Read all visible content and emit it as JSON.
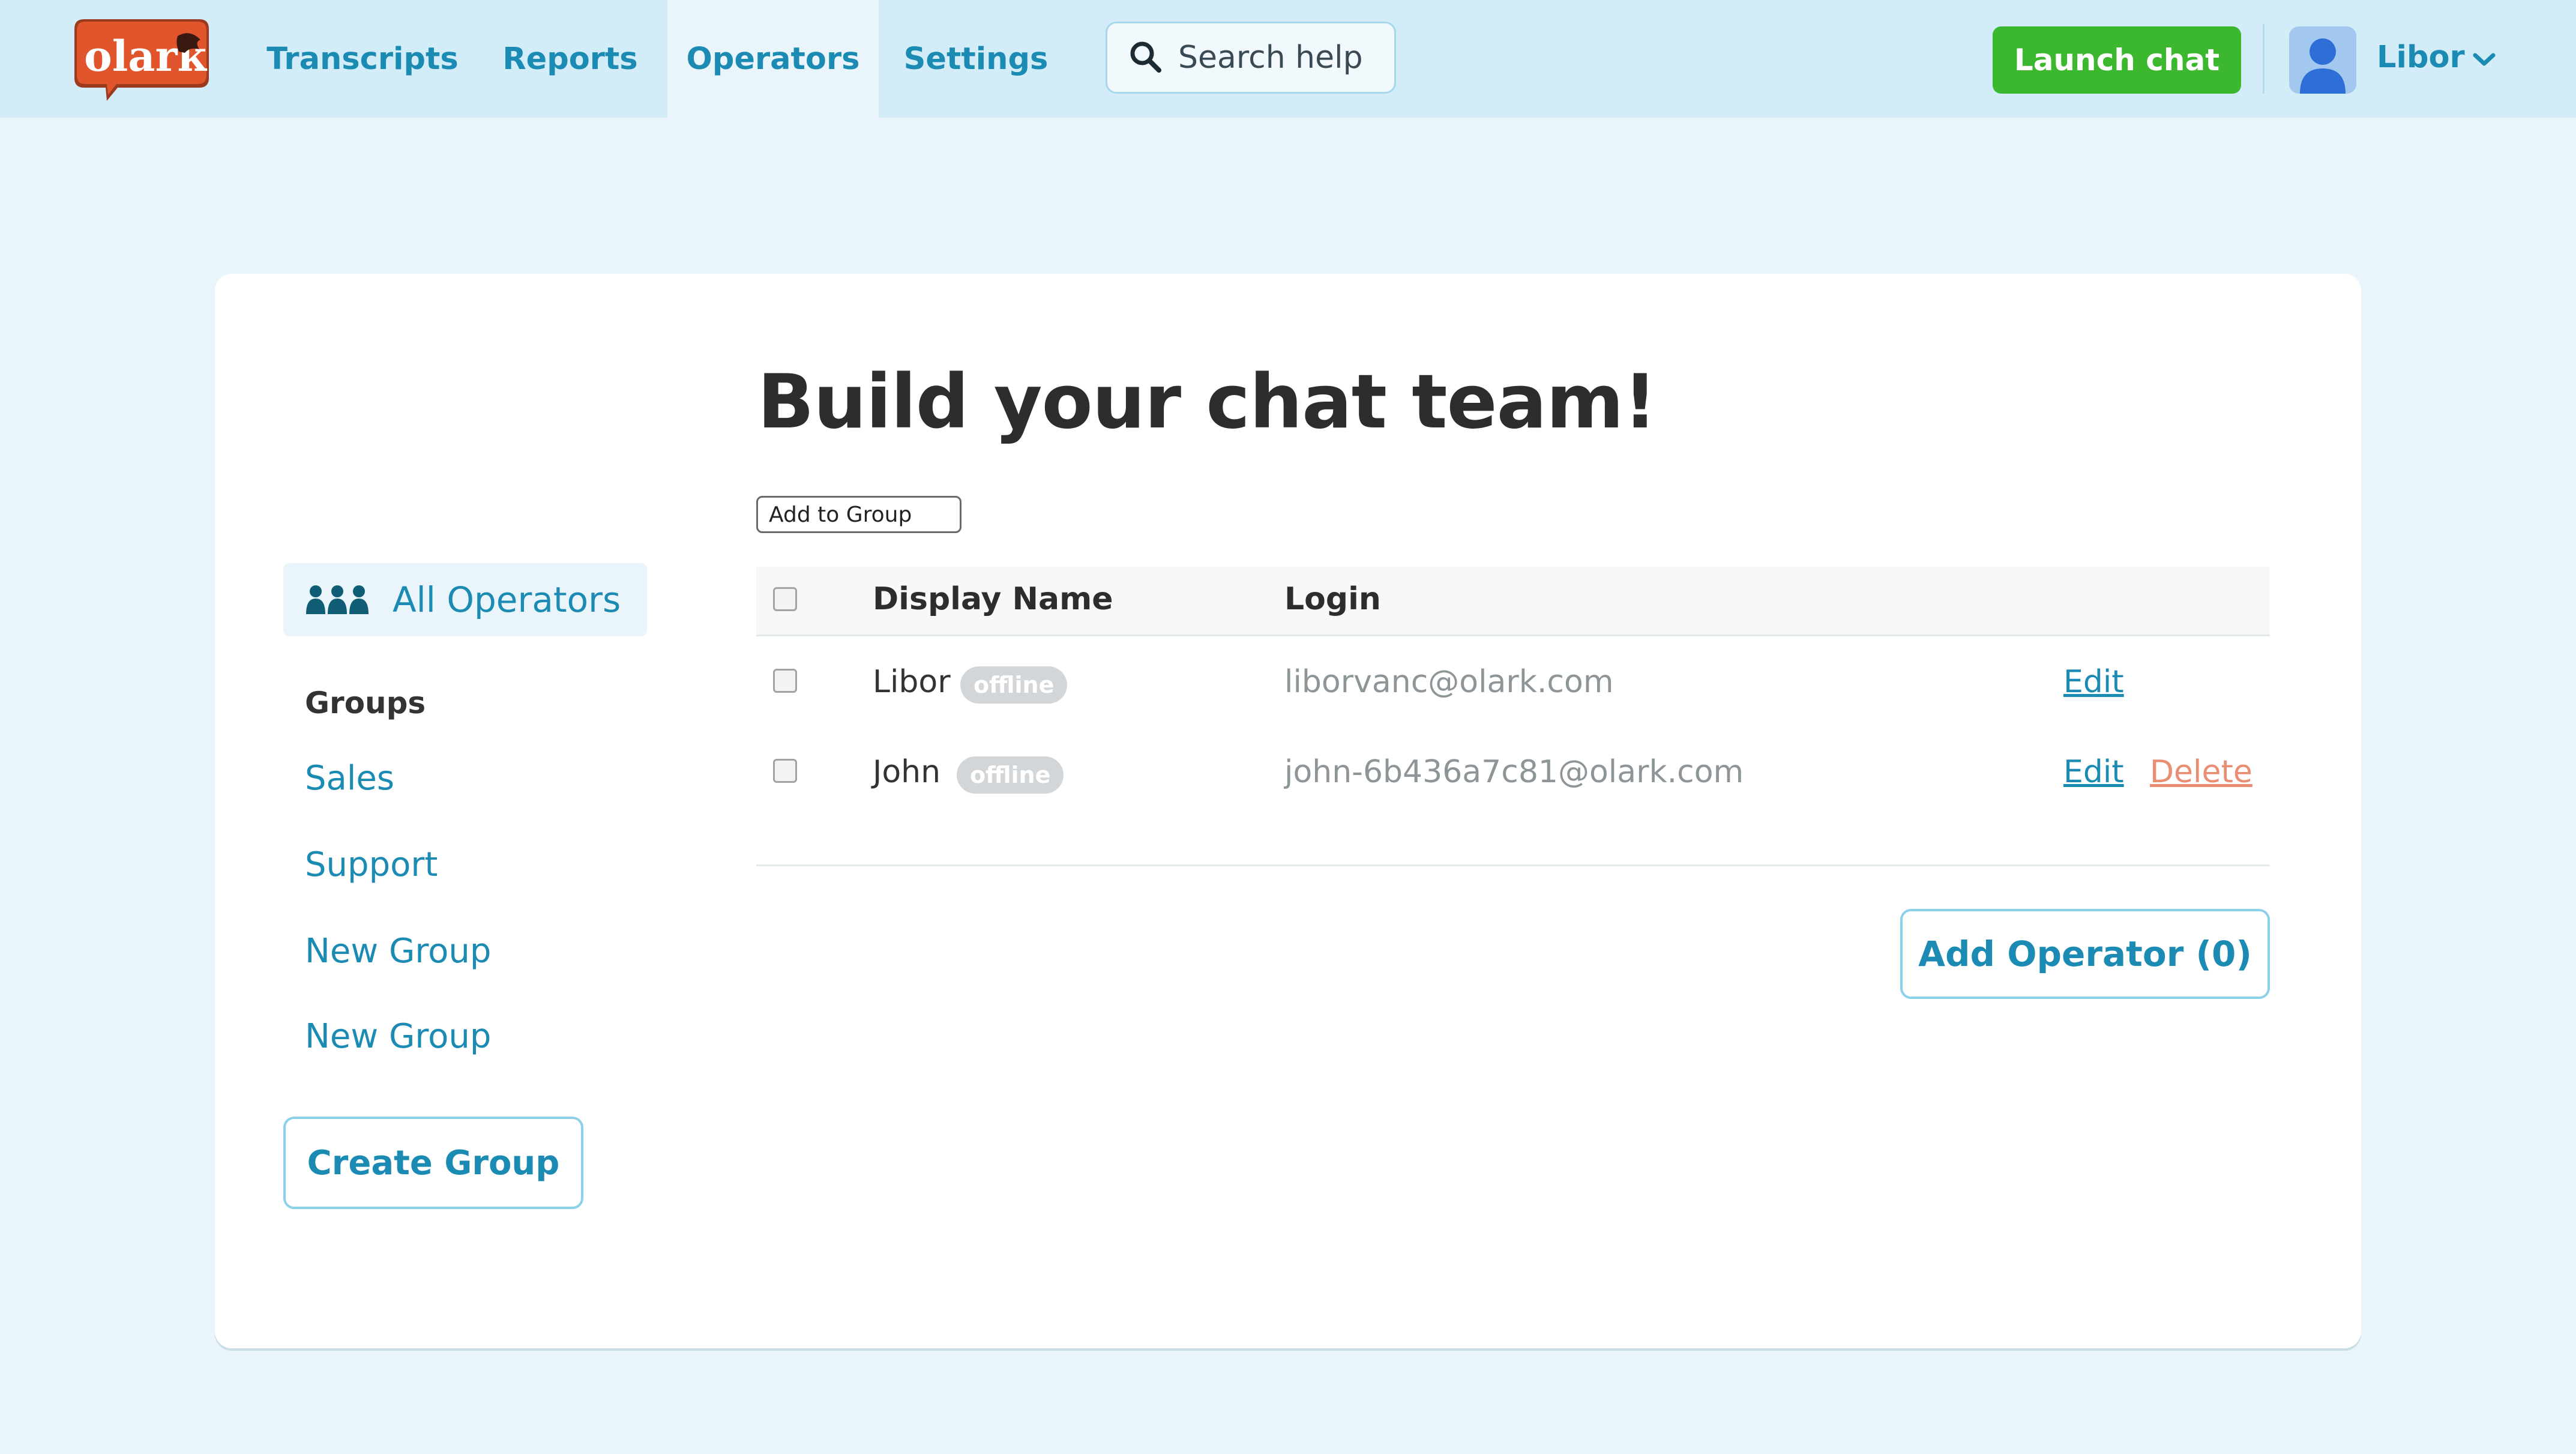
{
  "brand": {
    "logo_text": "olark",
    "colors": {
      "accent": "#1b8bb4",
      "launch_green": "#3cb82f",
      "logo_orange": "#e0552b",
      "delete": "#ea8e73"
    }
  },
  "nav": {
    "tabs": [
      {
        "label": "Transcripts",
        "active": false
      },
      {
        "label": "Reports",
        "active": false
      },
      {
        "label": "Operators",
        "active": true
      },
      {
        "label": "Settings",
        "active": false
      }
    ],
    "search_placeholder": "Search help",
    "search_icon": "search-icon",
    "launch_label": "Launch chat",
    "user_name": "Libor",
    "user_icon": "user-avatar-icon"
  },
  "main": {
    "title": "Build your chat team!",
    "add_to_group_label": "Add to Group"
  },
  "sidebar": {
    "all_operators_label": "All Operators",
    "all_operators_icon": "people-icon",
    "groups_heading": "Groups",
    "groups": [
      {
        "label": "Sales"
      },
      {
        "label": "Support"
      },
      {
        "label": "New Group"
      },
      {
        "label": "New Group"
      }
    ],
    "create_group_label": "Create Group"
  },
  "table": {
    "headers": {
      "display_name": "Display Name",
      "login": "Login"
    },
    "rows": [
      {
        "name": "Libor",
        "status": "offline",
        "login": "liborvanc@olark.com",
        "edit": "Edit",
        "delete": ""
      },
      {
        "name": "John",
        "status": "offline",
        "login": "john-6b436a7c81@olark.com",
        "edit": "Edit",
        "delete": "Delete"
      }
    ]
  },
  "add_operator_label": "Add Operator (0)"
}
